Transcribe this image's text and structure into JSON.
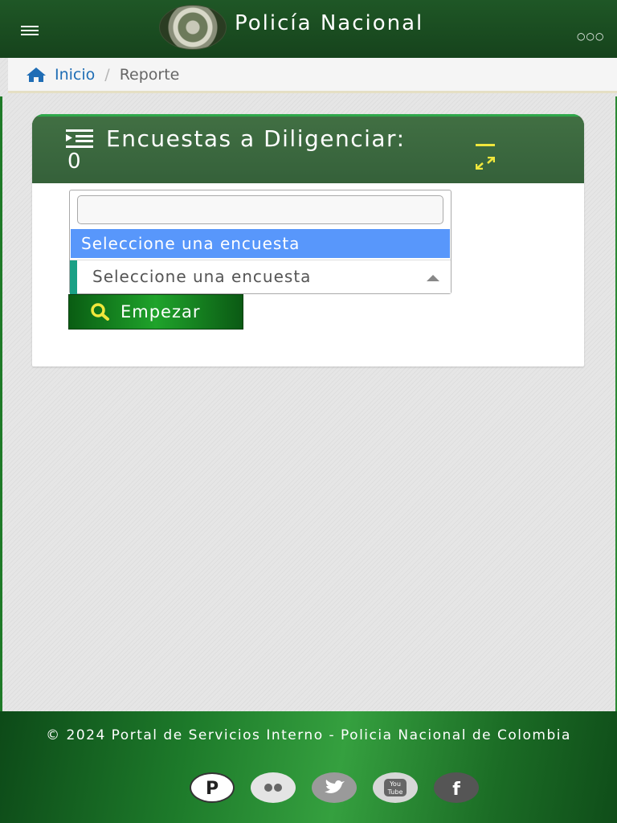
{
  "header": {
    "brand": "Policía Nacional"
  },
  "breadcrumb": {
    "home": "Inicio",
    "separator": "/",
    "current": "Reporte"
  },
  "panel": {
    "title": "Encuestas a Diligenciar:",
    "count": "0"
  },
  "dropdown": {
    "search_value": "",
    "highlighted_option": "Seleccione una encuesta",
    "selected_value": "Seleccione una encuesta"
  },
  "start_button": {
    "label": "Empezar"
  },
  "footer": {
    "copyright": "© 2024 Portal de Servicios Interno - Policia Nacional de Colombia",
    "social": [
      "pinterest",
      "flickr",
      "twitter",
      "youtube",
      "facebook"
    ]
  },
  "colors": {
    "navbar": "#1b4d22",
    "panel_header": "#3c6a3e",
    "highlight": "#5897fb",
    "accent": "#1aa085",
    "link": "#1f6db5"
  }
}
